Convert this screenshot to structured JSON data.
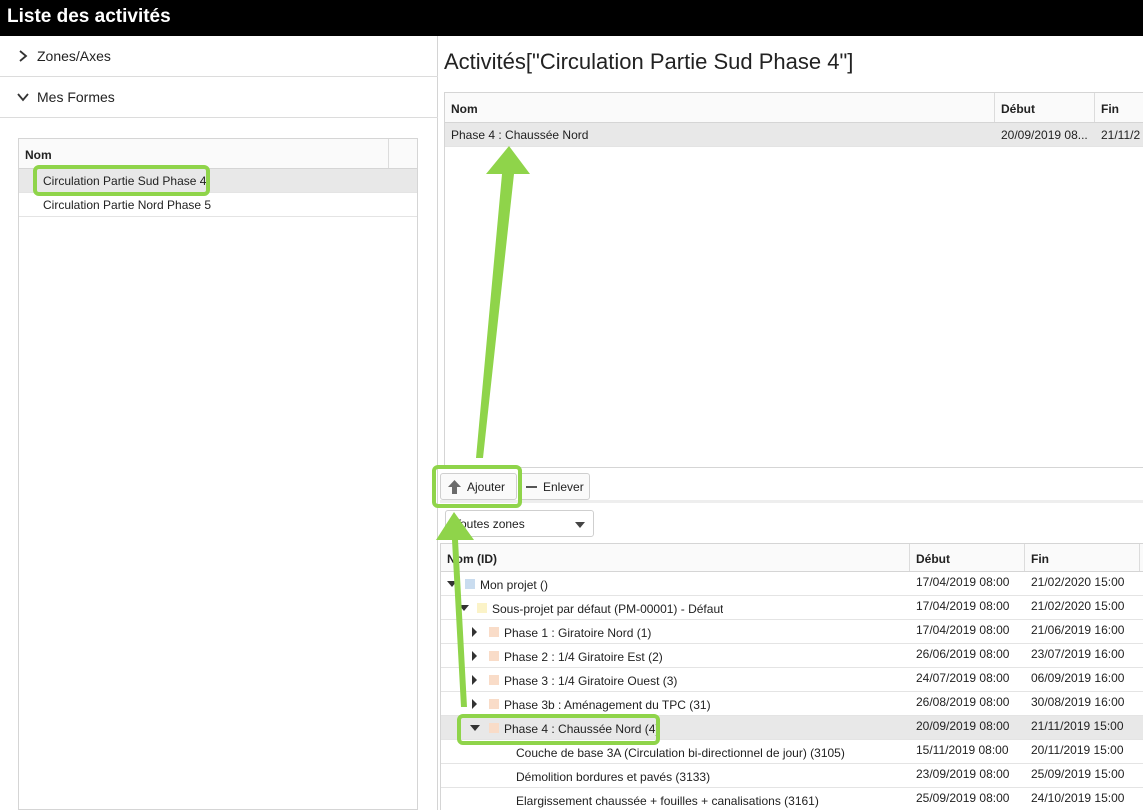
{
  "window": {
    "title": "Liste des activités"
  },
  "left_panel": {
    "accordion": [
      {
        "label": "Zones/Axes",
        "expanded": false
      },
      {
        "label": "Mes Formes",
        "expanded": true
      }
    ],
    "shapes_grid": {
      "header": "Nom",
      "rows": [
        "Circulation Partie Sud Phase 4",
        "Circulation Partie Nord Phase 5"
      ]
    }
  },
  "activities_panel": {
    "title": "Activités[\"Circulation Partie Sud Phase 4\"]",
    "headers": {
      "nom": "Nom",
      "debut": "Début",
      "fin": "Fin"
    },
    "rows": [
      {
        "nom": "Phase 4 : Chaussée Nord",
        "debut": "20/09/2019 08...",
        "fin": "21/11/2"
      }
    ]
  },
  "toolbar": {
    "add_label": "Ajouter",
    "remove_label": "Enlever"
  },
  "zones_select": {
    "value": "Toutes zones"
  },
  "tree_grid": {
    "headers": {
      "nom": "Nom (ID)",
      "debut": "Début",
      "fin": "Fin"
    },
    "rows": [
      {
        "name": "Mon projet ()",
        "debut": "17/04/2019 08:00",
        "fin": "21/02/2020 15:00"
      },
      {
        "name": "Sous-projet par défaut (PM-00001) - Défaut",
        "debut": "17/04/2019 08:00",
        "fin": "21/02/2020 15:00"
      },
      {
        "name": "Phase 1 : Giratoire Nord (1)",
        "debut": "17/04/2019 08:00",
        "fin": "21/06/2019 16:00"
      },
      {
        "name": "Phase 2 : 1/4 Giratoire Est (2)",
        "debut": "26/06/2019 08:00",
        "fin": "23/07/2019 16:00"
      },
      {
        "name": "Phase 3 : 1/4 Giratoire Ouest (3)",
        "debut": "24/07/2019 08:00",
        "fin": "06/09/2019 16:00"
      },
      {
        "name": "Phase 3b : Aménagement du TPC (31)",
        "debut": "26/08/2019 08:00",
        "fin": "30/08/2019 16:00"
      },
      {
        "name": "Phase 4 : Chaussée Nord (4)",
        "debut": "20/09/2019 08:00",
        "fin": "21/11/2019 15:00"
      },
      {
        "name": "Couche de base 3A (Circulation bi-directionnel de jour) (3105)",
        "debut": "15/11/2019 08:00",
        "fin": "20/11/2019 15:00"
      },
      {
        "name": "Démolition bordures et pavés (3133)",
        "debut": "23/09/2019 08:00",
        "fin": "25/09/2019 15:00"
      },
      {
        "name": "Elargissement chaussée + fouilles + canalisations (3161)",
        "debut": "25/09/2019 08:00",
        "fin": "24/10/2019 15:00"
      }
    ]
  },
  "colors": {
    "highlight": "#8fd44a",
    "selected_row": "#e8e8e8",
    "project_swatch": "#c9dcef",
    "subproject_swatch": "#fbf3c8",
    "phase_swatch": "#f9dcc8"
  }
}
